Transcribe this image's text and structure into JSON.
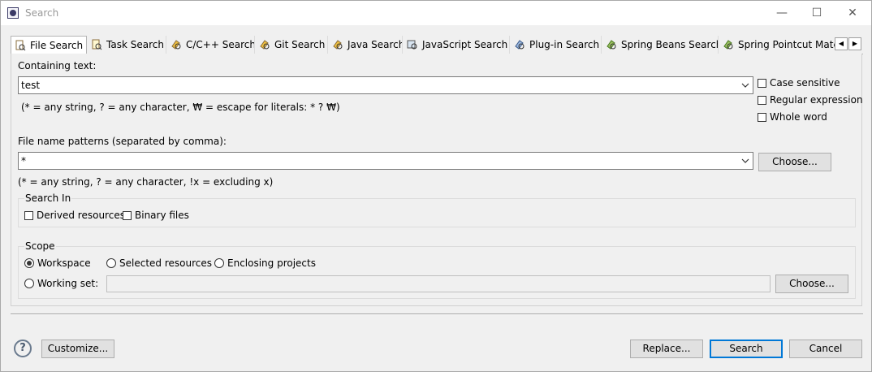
{
  "window": {
    "title": "Search",
    "minimize": "—",
    "maximize": "☐",
    "close": "✕"
  },
  "tabs": [
    {
      "label": "File Search",
      "icon": "file-search-icon"
    },
    {
      "label": "Task Search",
      "icon": "task-search-icon"
    },
    {
      "label": "C/C++ Search",
      "icon": "cpp-search-icon"
    },
    {
      "label": "Git Search",
      "icon": "git-search-icon"
    },
    {
      "label": "Java Search",
      "icon": "java-search-icon"
    },
    {
      "label": "JavaScript Search",
      "icon": "javascript-search-icon"
    },
    {
      "label": "Plug-in Search",
      "icon": "plugin-search-icon"
    },
    {
      "label": "Spring Beans Search",
      "icon": "spring-beans-search-icon"
    },
    {
      "label": "Spring Pointcut Matc",
      "icon": "spring-pointcut-icon"
    }
  ],
  "tab_scroll": {
    "left": "◀",
    "right": "▶"
  },
  "containing": {
    "label": "Containing text:",
    "value": "test",
    "hint": "(* = any string, ? = any character, ₩ = escape for literals: * ? ₩)"
  },
  "options": {
    "case_sensitive": "Case sensitive",
    "regex": "Regular expression",
    "whole_word": "Whole word"
  },
  "file_patterns": {
    "label": "File name patterns (separated by comma):",
    "value": "*",
    "hint": "(* = any string, ? = any character, !x = excluding x)",
    "choose": "Choose..."
  },
  "search_in": {
    "title": "Search In",
    "derived": "Derived resources",
    "binary": "Binary files"
  },
  "scope": {
    "title": "Scope",
    "workspace": "Workspace",
    "selected": "Selected resources",
    "enclosing": "Enclosing projects",
    "working_set": "Working set:",
    "choose": "Choose..."
  },
  "footer": {
    "help": "?",
    "customize": "Customize...",
    "replace": "Replace...",
    "search": "Search",
    "cancel": "Cancel"
  }
}
